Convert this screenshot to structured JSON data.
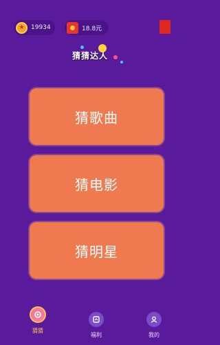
{
  "header": {
    "coins": "19934",
    "cash": "18.8元"
  },
  "logo": {
    "title": "猜猜达人"
  },
  "menu": {
    "items": [
      {
        "label": "猜歌曲"
      },
      {
        "label": "猜电影"
      },
      {
        "label": "猜明星"
      }
    ]
  },
  "tabbar": {
    "tabs": [
      {
        "label": "猜猜",
        "icon": "guess-icon",
        "active": true
      },
      {
        "label": "福利",
        "icon": "welfare-icon",
        "active": false
      },
      {
        "label": "我的",
        "icon": "profile-icon",
        "active": false
      }
    ]
  },
  "colors": {
    "background": "#5a1a9c",
    "button": "#f07a50",
    "active_tab": "#ffc24a"
  }
}
